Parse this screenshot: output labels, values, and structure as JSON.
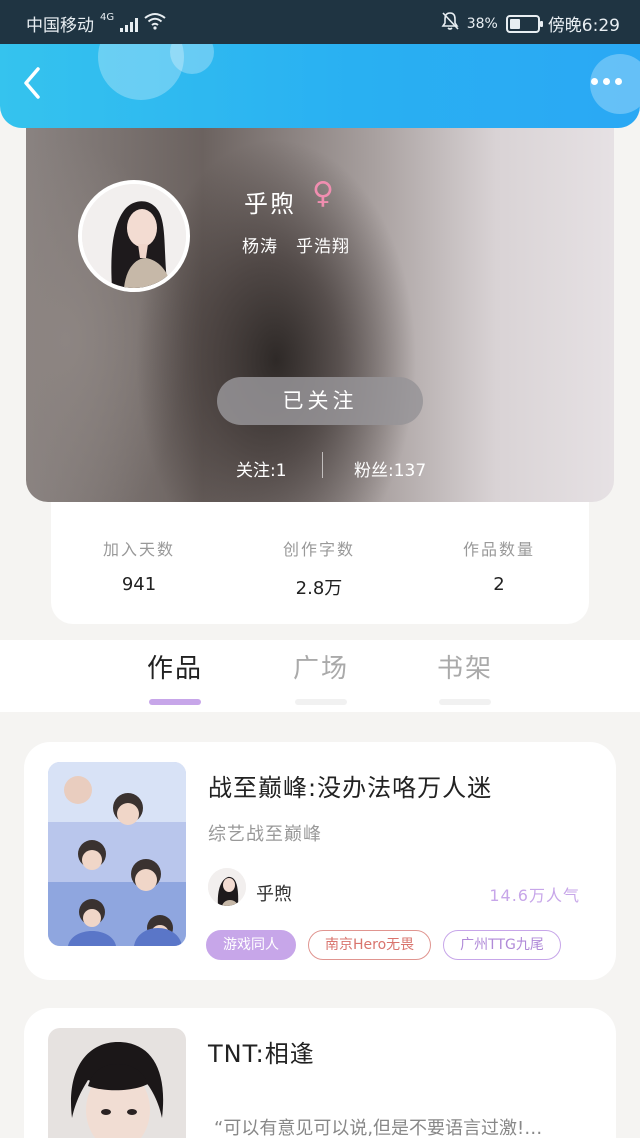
{
  "status_bar": {
    "carrier": "中国移动",
    "network": "4G",
    "battery_percent": "38%",
    "battery_level": 0.38,
    "time": "傍晚6:29"
  },
  "header": {
    "back_icon": "chevron-left-icon",
    "more_icon": "more-dots-icon",
    "gradient_from": "#35c3ee",
    "gradient_to": "#2aa8f4"
  },
  "profile": {
    "name": "乎煦",
    "gender_symbol": "♀",
    "cp_tags": "杨涛　乎浩翔",
    "follow_button": "已关注",
    "following_text": "关注:1",
    "fans_text": "粉丝:137"
  },
  "stats": [
    {
      "label": "加入天数",
      "value": "941"
    },
    {
      "label": "创作字数",
      "value": "2.8万"
    },
    {
      "label": "作品数量",
      "value": "2"
    }
  ],
  "tabs": [
    {
      "label": "作品",
      "active": true
    },
    {
      "label": "广场",
      "active": false
    },
    {
      "label": "书架",
      "active": false
    }
  ],
  "works": [
    {
      "title": "战至巅峰:没办法咯万人迷",
      "subtitle": "综艺战至巅峰",
      "author": "乎煦",
      "popularity": "14.6万人气",
      "tags": [
        "游戏同人",
        "南京Hero无畏",
        "广州TTG九尾"
      ]
    },
    {
      "title": "TNT:相逢",
      "quote": "“可以有意见可以说,但是不要语言过激!…"
    }
  ],
  "accent_color": "#c7a6e9"
}
